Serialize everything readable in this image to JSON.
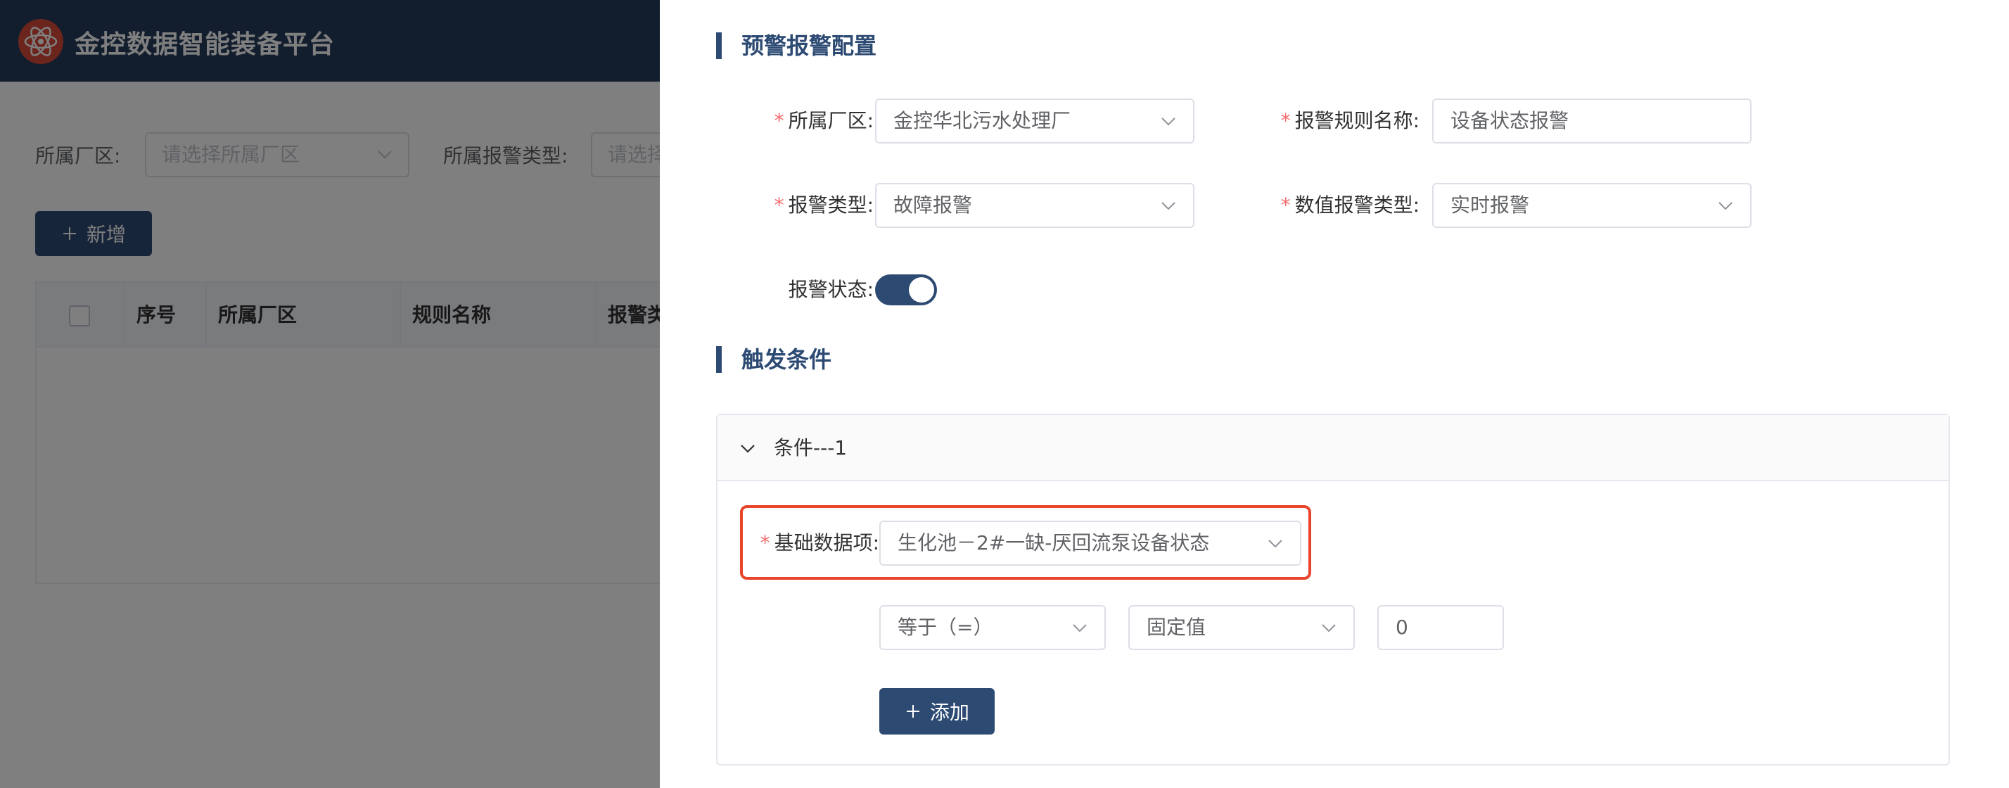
{
  "app": {
    "title": "金控数据智能装备平台",
    "logo_icon": "atom-logo-icon",
    "brand_color": "#243b5a",
    "accent_color": "#2d4a73",
    "highlight_color": "#e8452c"
  },
  "background_page": {
    "filters": {
      "plant_label": "所属厂区:",
      "plant_placeholder": "请选择所属厂区",
      "alarm_type_label": "所属报警类型:",
      "alarm_type_placeholder": "请选择"
    },
    "add_button": "新增",
    "table": {
      "columns": [
        "序号",
        "所属厂区",
        "规则名称",
        "报警类型"
      ]
    }
  },
  "drawer": {
    "section_alarm_config": "预警报警配置",
    "plant": {
      "label": "所属厂区:",
      "value": "金控华北污水处理厂"
    },
    "rule_name": {
      "label": "报警规则名称:",
      "value": "设备状态报警"
    },
    "alarm_type": {
      "label": "报警类型:",
      "value": "故障报警"
    },
    "value_alarm_type": {
      "label": "数值报警类型:",
      "value": "实时报警"
    },
    "alarm_status": {
      "label": "报警状态:",
      "enabled": true
    },
    "section_trigger": "触发条件",
    "condition": {
      "title": "条件---1",
      "base_item": {
        "label": "基础数据项:",
        "value": "生化池－2#一缺-厌回流泵设备状态"
      },
      "operator": "等于（=）",
      "value_type": "固定值",
      "value": "0",
      "add_button": "添加"
    }
  }
}
